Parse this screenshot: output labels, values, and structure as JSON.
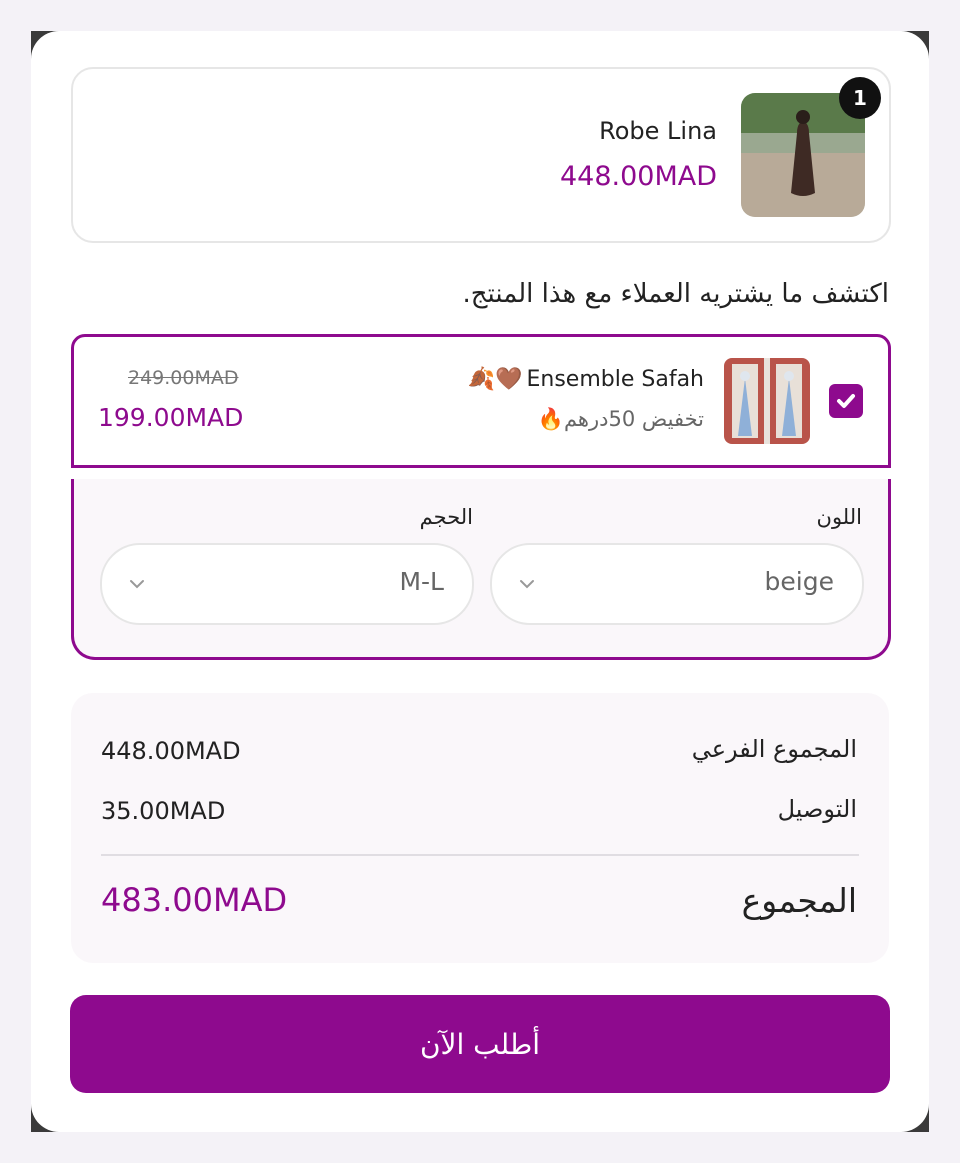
{
  "cart_item": {
    "quantity": "1",
    "name": "Robe Lina",
    "price": "448.00MAD"
  },
  "upsell": {
    "heading": "اكتشف ما يشتريه العملاء مع هذا المنتج.",
    "offer": {
      "checked": true,
      "name": "Ensemble Safah",
      "name_emojis": "🍂🤎",
      "subtitle": "تخفيض 50درهم🔥",
      "old_price": "249.00MAD",
      "new_price": "199.00MAD"
    },
    "variants": {
      "color_label": "اللون",
      "color_value": "beige",
      "size_label": "الحجم",
      "size_value": "M-L"
    }
  },
  "summary": {
    "subtotal_label": "المجموع الفرعي",
    "subtotal_value": "448.00MAD",
    "shipping_label": "التوصيل",
    "shipping_value": "35.00MAD",
    "total_label": "المجموع",
    "total_value": "483.00MAD"
  },
  "order_button": "أطلب الآن",
  "colors": {
    "accent": "#8e0a8e",
    "background": "#f4f2f7"
  }
}
